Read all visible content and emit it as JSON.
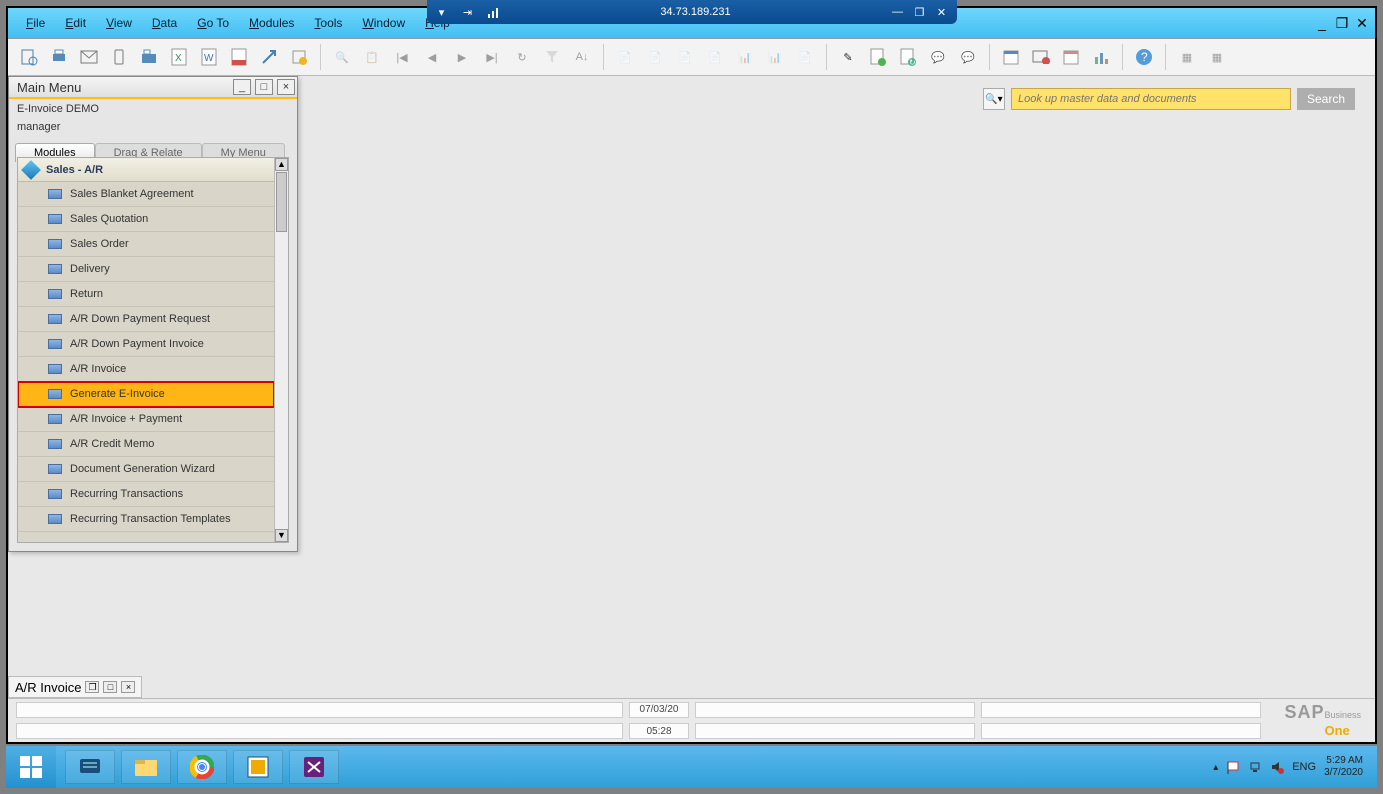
{
  "rdp": {
    "ip": "34.73.189.231"
  },
  "menubar": {
    "file": "File",
    "edit": "Edit",
    "view": "View",
    "data": "Data",
    "goto": "Go To",
    "modules": "Modules",
    "tools": "Tools",
    "window": "Window",
    "help": "Help"
  },
  "search": {
    "placeholder": "Look up master data and documents",
    "button": "Search"
  },
  "mainMenu": {
    "title": "Main Menu",
    "company": "E-Invoice DEMO",
    "user": "manager",
    "tabs": {
      "modules": "Modules",
      "drag": "Drag & Relate",
      "my": "My Menu"
    },
    "section": "Sales - A/R",
    "items": [
      {
        "label": "Sales Blanket Agreement",
        "selected": false
      },
      {
        "label": "Sales Quotation",
        "selected": false
      },
      {
        "label": "Sales Order",
        "selected": false
      },
      {
        "label": "Delivery",
        "selected": false
      },
      {
        "label": "Return",
        "selected": false
      },
      {
        "label": "A/R Down Payment Request",
        "selected": false
      },
      {
        "label": "A/R Down Payment Invoice",
        "selected": false
      },
      {
        "label": "A/R Invoice",
        "selected": false
      },
      {
        "label": "Generate E-Invoice",
        "selected": true
      },
      {
        "label": "A/R Invoice + Payment",
        "selected": false
      },
      {
        "label": "A/R Credit Memo",
        "selected": false
      },
      {
        "label": "Document Generation Wizard",
        "selected": false
      },
      {
        "label": "Recurring Transactions",
        "selected": false
      },
      {
        "label": "Recurring Transaction Templates",
        "selected": false
      }
    ]
  },
  "secondaryTab": "A/R Invoice",
  "status": {
    "date": "07/03/20",
    "time": "05:28"
  },
  "logo": {
    "sap": "SAP",
    "business": "Business",
    "one": "One"
  },
  "tray": {
    "lang": "ENG",
    "time": "5:29 AM",
    "date": "3/7/2020"
  }
}
